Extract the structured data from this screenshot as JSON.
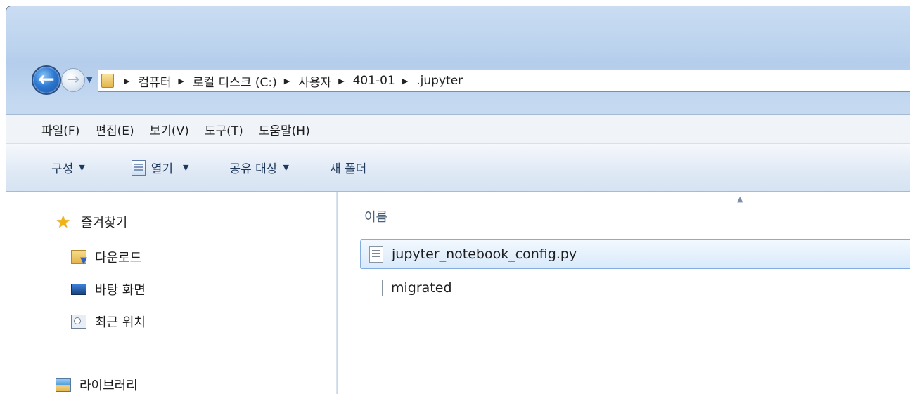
{
  "address": {
    "crumbs": [
      "컴퓨터",
      "로컬 디스크 (C:)",
      "사용자",
      "401-01",
      ".jupyter"
    ]
  },
  "menu": {
    "items": [
      "파일(F)",
      "편집(E)",
      "보기(V)",
      "도구(T)",
      "도움말(H)"
    ]
  },
  "toolbar": {
    "organize_label": "구성",
    "open_label": "열기",
    "share_label": "공유 대상",
    "new_folder_label": "새 폴더"
  },
  "navigation": {
    "favorites_label": "즐겨찾기",
    "items": [
      {
        "label": "다운로드",
        "icon": "downloads-folder-icon"
      },
      {
        "label": "바탕 화면",
        "icon": "desktop-icon"
      },
      {
        "label": "최근 위치",
        "icon": "recent-places-icon"
      }
    ],
    "libraries_label": "라이브러리"
  },
  "file_list": {
    "column_name": "이름",
    "files": [
      {
        "name": "jupyter_notebook_config.py",
        "selected": true,
        "icon": "python-file-icon"
      },
      {
        "name": "migrated",
        "selected": false,
        "icon": "blank-file-icon"
      }
    ]
  }
}
